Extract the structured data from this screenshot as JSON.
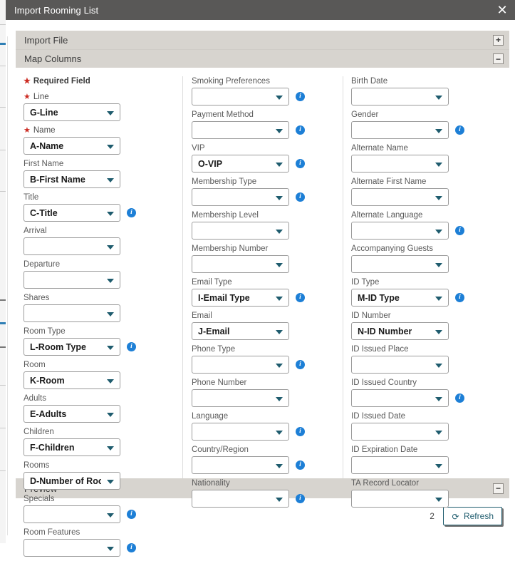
{
  "window": {
    "title": "Import Rooming List",
    "close_label": "✕"
  },
  "sections": [
    {
      "name": "import_file",
      "label": "Import File",
      "toggle": "+",
      "expanded": false
    },
    {
      "name": "map_columns",
      "label": "Map Columns",
      "toggle": "−",
      "expanded": true
    }
  ],
  "legend": {
    "star": "★",
    "text": "Required Field"
  },
  "columns": [
    {
      "id": "column-1",
      "fields": [
        {
          "label": "Line",
          "value": "G-Line",
          "required": true,
          "info": false
        },
        {
          "label": "Name",
          "value": "A-Name",
          "required": true,
          "info": false
        },
        {
          "label": "First Name",
          "value": "B-First Name",
          "required": false,
          "info": false
        },
        {
          "label": "Title",
          "value": "C-Title",
          "required": false,
          "info": true
        },
        {
          "label": "Arrival",
          "value": "",
          "required": false,
          "info": false
        },
        {
          "label": "Departure",
          "value": "",
          "required": false,
          "info": false
        },
        {
          "label": "Shares",
          "value": "",
          "required": false,
          "info": false
        },
        {
          "label": "Room Type",
          "value": "L-Room Type",
          "required": false,
          "info": true
        },
        {
          "label": "Room",
          "value": "K-Room",
          "required": false,
          "info": false
        },
        {
          "label": "Adults",
          "value": "E-Adults",
          "required": false,
          "info": false
        },
        {
          "label": "Children",
          "value": "F-Children",
          "required": false,
          "info": false
        },
        {
          "label": "Rooms",
          "value": "D-Number of Rooms",
          "required": false,
          "info": false
        },
        {
          "label": "Specials",
          "value": "",
          "required": false,
          "info": true
        },
        {
          "label": "Room Features",
          "value": "",
          "required": false,
          "info": true
        }
      ]
    },
    {
      "id": "column-2",
      "fields": [
        {
          "label": "Smoking Preferences",
          "value": "",
          "required": false,
          "info": true
        },
        {
          "label": "Payment Method",
          "value": "",
          "required": false,
          "info": true
        },
        {
          "label": "VIP",
          "value": "O-VIP",
          "required": false,
          "info": true
        },
        {
          "label": "Membership Type",
          "value": "",
          "required": false,
          "info": true
        },
        {
          "label": "Membership Level",
          "value": "",
          "required": false,
          "info": false
        },
        {
          "label": "Membership Number",
          "value": "",
          "required": false,
          "info": false
        },
        {
          "label": "Email Type",
          "value": "I-Email Type",
          "required": false,
          "info": true
        },
        {
          "label": "Email",
          "value": "J-Email",
          "required": false,
          "info": false
        },
        {
          "label": "Phone Type",
          "value": "",
          "required": false,
          "info": true
        },
        {
          "label": "Phone Number",
          "value": "",
          "required": false,
          "info": false
        },
        {
          "label": "Language",
          "value": "",
          "required": false,
          "info": true
        },
        {
          "label": "Country/Region",
          "value": "",
          "required": false,
          "info": true
        },
        {
          "label": "Nationality",
          "value": "",
          "required": false,
          "info": true
        }
      ]
    },
    {
      "id": "column-3",
      "fields": [
        {
          "label": "Birth Date",
          "value": "",
          "required": false,
          "info": false
        },
        {
          "label": "Gender",
          "value": "",
          "required": false,
          "info": true
        },
        {
          "label": "Alternate Name",
          "value": "",
          "required": false,
          "info": false
        },
        {
          "label": "Alternate First Name",
          "value": "",
          "required": false,
          "info": false
        },
        {
          "label": "Alternate Language",
          "value": "",
          "required": false,
          "info": true
        },
        {
          "label": "Accompanying Guests",
          "value": "",
          "required": false,
          "info": false
        },
        {
          "label": "ID Type",
          "value": "M-ID Type",
          "required": false,
          "info": true
        },
        {
          "label": "ID Number",
          "value": "N-ID Number",
          "required": false,
          "info": false
        },
        {
          "label": "ID Issued Place",
          "value": "",
          "required": false,
          "info": false
        },
        {
          "label": "ID Issued Country",
          "value": "",
          "required": false,
          "info": true
        },
        {
          "label": "ID Issued Date",
          "value": "",
          "required": false,
          "info": false
        },
        {
          "label": "ID Expiration Date",
          "value": "",
          "required": false,
          "info": false
        },
        {
          "label": "TA Record Locator",
          "value": "",
          "required": false,
          "info": false
        }
      ]
    }
  ],
  "preview": {
    "label": "Preview",
    "toggle": "−"
  },
  "footer": {
    "record_count": "2",
    "refresh_label": "Refresh",
    "refresh_icon": "⟳"
  },
  "colors": {
    "titlebar": "#595857",
    "accordion": "#d7d4cf",
    "accent": "#1f5c6e",
    "info_blue": "#1d7fd6",
    "required_red": "#cc2b22"
  }
}
